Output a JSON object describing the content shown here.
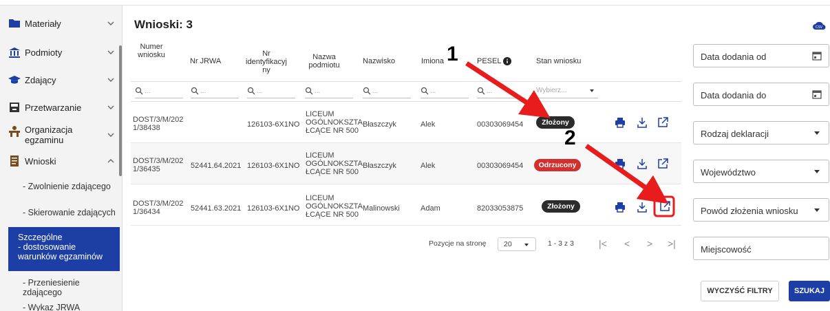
{
  "sidebar": {
    "items": [
      {
        "label": "Materiały"
      },
      {
        "label": "Podmioty"
      },
      {
        "label": "Zdający"
      },
      {
        "label": "Przetwarzanie"
      },
      {
        "label": "Organizacja egzaminu"
      },
      {
        "label": "Wnioski"
      }
    ],
    "subitems": [
      {
        "label": "- Zwolnienie zdającego"
      },
      {
        "label": "- Skierowanie zdających"
      },
      {
        "label": "Szczególne - dostosowanie warunków egzaminów"
      },
      {
        "label": "- Przeniesienie zdającego"
      },
      {
        "label": "- Wykaz JRWA"
      }
    ]
  },
  "main": {
    "title": "Wnioski: 3",
    "headers": [
      "Numer wniosku",
      "Nr JRWA",
      "Nr identyfikacyjny",
      "Nazwa podmiotu",
      "Nazwisko",
      "Imiona",
      "PESEL",
      "Stan wniosku"
    ],
    "filter_placeholder": "Q...",
    "select_placeholder": "Wybierz...",
    "rows": [
      {
        "numer": "DOST/3/M/2021/38438",
        "jrwa": "",
        "nrid": "126103-6X1NO",
        "podmiot": "LICEUM OGÓLNOKSZTAŁCĄCE NR 500",
        "nazwisko": "Błaszczyk",
        "imiona": "Alek",
        "pesel": "00303069454",
        "stan": "Złożony"
      },
      {
        "numer": "DOST/3/M/2021/36435",
        "jrwa": "52441.64.2021",
        "nrid": "126103-6X1NO",
        "podmiot": "LICEUM OGÓLNOKSZTAŁCĄCE NR 500",
        "nazwisko": "Błaszczyk",
        "imiona": "Alek",
        "pesel": "00303069454",
        "stan": "Odrzucony"
      },
      {
        "numer": "DOST/3/M/2021/36434",
        "jrwa": "52441.63.2021",
        "nrid": "126103-6X1NO",
        "podmiot": "LICEUM OGÓLNOKSZTAŁCĄCE NR 500",
        "nazwisko": "Malinowski",
        "imiona": "Adam",
        "pesel": "82033053875",
        "stan": "Złożony"
      }
    ],
    "pager": {
      "label": "Pozycje na stronę",
      "size": "20",
      "range": "1 - 3 z 3"
    }
  },
  "filters": {
    "date_from": "Data dodania od",
    "date_to": "Data dodania do",
    "declaration_type": "Rodzaj deklaracji",
    "voivodeship": "Województwo",
    "reason": "Powód złożenia wniosku",
    "city": "Miejscowość",
    "clear_label": "WYCZYŚĆ FILTRY",
    "search_label": "SZUKAJ"
  },
  "annotations": {
    "one": "1",
    "two": "2"
  },
  "colors": {
    "primary": "#1d3fa5",
    "status_submitted": "#2b2b2b",
    "status_rejected": "#d32f2f",
    "annotation": "#e81c1c"
  }
}
